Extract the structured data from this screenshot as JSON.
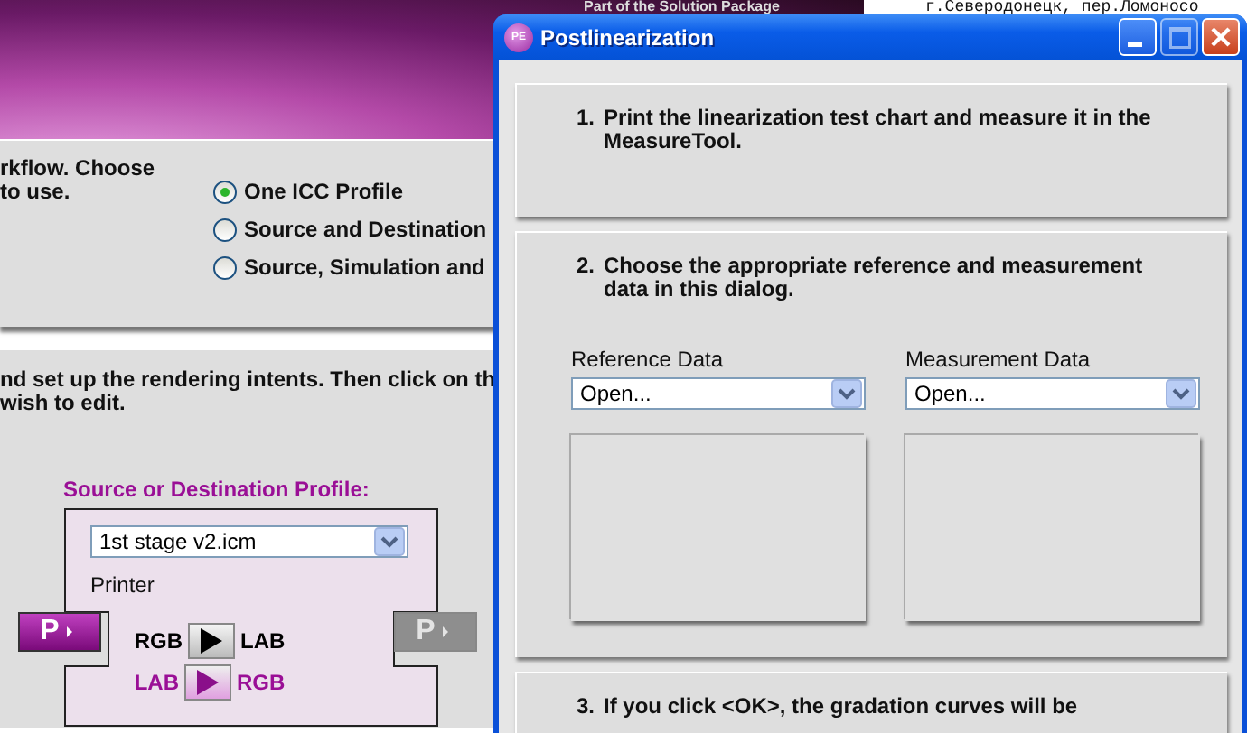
{
  "background_window": {
    "banner_caption": "Part of the Solution Package",
    "address": "г.Северодонецк, пер.Ломоносо",
    "workflow_panel": {
      "text_lines": [
        "rkflow. Choose",
        "to use."
      ],
      "options": [
        {
          "label": "One ICC Profile",
          "selected": true
        },
        {
          "label": "Source and Destination",
          "selected": false
        },
        {
          "label": "Source, Simulation and",
          "selected": false
        }
      ]
    },
    "profile_panel": {
      "text_lines": [
        "nd set up the rendering intents. Then click on th",
        "wish to edit."
      ],
      "profile_label": "Source or Destination Profile:",
      "profile_select": {
        "value": "1st stage v2.icm"
      },
      "device": "Printer",
      "side_buttons": [
        {
          "label": "P",
          "disabled": false
        },
        {
          "label": "P",
          "disabled": true
        }
      ],
      "conversions": [
        {
          "from": "RGB",
          "to": "LAB",
          "kind": "forward"
        },
        {
          "from": "LAB",
          "to": "RGB",
          "kind": "reverse"
        }
      ]
    }
  },
  "dialog": {
    "title": "Postlinearization",
    "icon_text": "PE",
    "controls": [
      {
        "kind": "minimize",
        "disabled": false
      },
      {
        "kind": "maximize",
        "disabled": true
      },
      {
        "kind": "close",
        "disabled": false
      }
    ],
    "steps": [
      {
        "kind": "text",
        "number": "1.",
        "text": "Print the linearization test chart and measure it in the MeasureTool."
      },
      {
        "kind": "data",
        "number": "2.",
        "text": "Choose the appropriate reference and measurement data in this dialog.",
        "fields": [
          {
            "label": "Reference Data",
            "value": "Open..."
          },
          {
            "label": "Measurement Data",
            "value": "Open..."
          }
        ]
      },
      {
        "kind": "text",
        "number": "3.",
        "text": "If you click <OK>, the gradation curves will be"
      }
    ]
  }
}
